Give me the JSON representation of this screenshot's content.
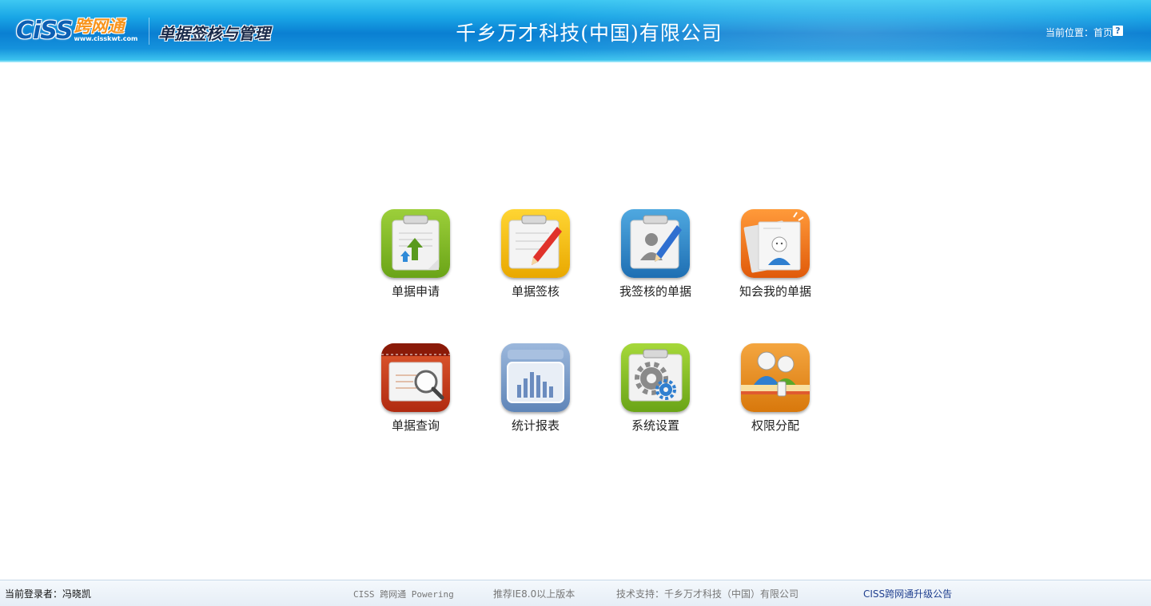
{
  "header": {
    "logo_text": "CiSS",
    "logo_cn": "跨网通",
    "logo_url": "www.cisskwt.com",
    "app_title": "单据签核与管理",
    "company": "千乡万才科技(中国)有限公司",
    "location_label": "当前位置：",
    "location_value": "首页",
    "help_symbol": "?"
  },
  "menu": [
    {
      "label": "单据申请",
      "icon": "clipboard-upload-icon",
      "color": "#7ab51d"
    },
    {
      "label": "单据签核",
      "icon": "clipboard-pencil-icon",
      "color": "#f2b705"
    },
    {
      "label": "我签核的单据",
      "icon": "clipboard-user-pencil-icon",
      "color": "#2f87c9"
    },
    {
      "label": "知会我的单据",
      "icon": "documents-user-icon",
      "color": "#ef6f18"
    },
    {
      "label": "单据查询",
      "icon": "magnifier-document-icon",
      "color": "#c7381b"
    },
    {
      "label": "统计报表",
      "icon": "bar-chart-icon",
      "color": "#7b9cc7"
    },
    {
      "label": "系统设置",
      "icon": "gear-settings-icon",
      "color": "#7ab51d"
    },
    {
      "label": "权限分配",
      "icon": "users-permission-icon",
      "color": "#e88a1a"
    }
  ],
  "footer": {
    "user_label": "当前登录者：",
    "user_name": "冯晓凯",
    "powered": "CISS 跨网通 Powering",
    "ie_notice": "推荐IE8.0以上版本",
    "support": "技术支持：千乡万才科技（中国）有限公司",
    "upgrade_notice": "CISS跨网通升级公告"
  }
}
